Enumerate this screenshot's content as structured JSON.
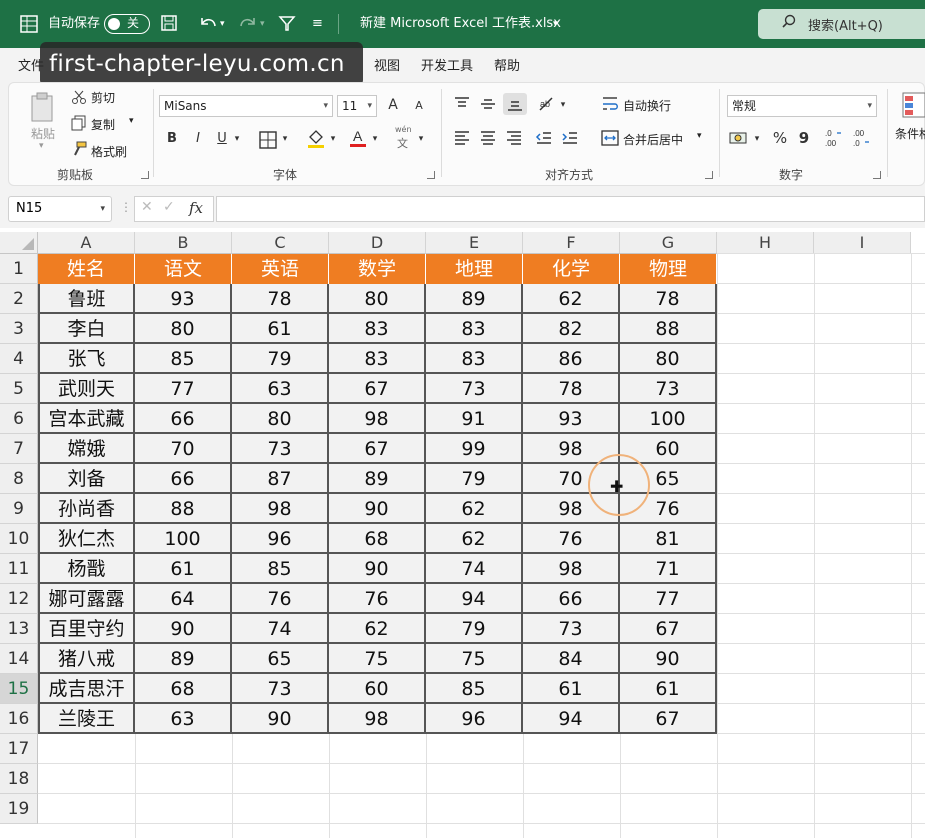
{
  "titlebar": {
    "autosave_label": "自动保存",
    "autosave_state": "关",
    "filename": "新建 Microsoft Excel 工作表.xlsx",
    "search_label": "搜索(Alt+Q)",
    "accent": "#1e7145"
  },
  "menu": {
    "items": [
      "文件",
      "视图",
      "开发工具",
      "帮助"
    ]
  },
  "watermark": "first-chapter-leyu.com.cn",
  "ribbon": {
    "clipboard": {
      "paste": "粘贴",
      "cut": "剪切",
      "copy": "复制",
      "format_painter": "格式刷",
      "group": "剪贴板"
    },
    "font": {
      "name": "MiSans",
      "size": "11",
      "grow": "A",
      "shrink": "A",
      "bold": "B",
      "italic": "I",
      "underline": "U",
      "phonetic_top": "wén",
      "phonetic_bottom": "文",
      "group": "字体"
    },
    "alignment": {
      "wrap": "自动换行",
      "merge": "合并后居中",
      "group": "对齐方式"
    },
    "number": {
      "format": "常规",
      "percent": "%",
      "comma": "9",
      "group": "数字"
    },
    "styles": {
      "cond": "条件格"
    }
  },
  "formula_bar": {
    "namebox": "N15",
    "fx": "fx",
    "formula": ""
  },
  "grid": {
    "columns": [
      "A",
      "B",
      "C",
      "D",
      "E",
      "F",
      "G",
      "H",
      "I"
    ],
    "rows": [
      "1",
      "2",
      "3",
      "4",
      "5",
      "6",
      "7",
      "8",
      "9",
      "10",
      "11",
      "12",
      "13",
      "14",
      "15",
      "16",
      "17",
      "18",
      "19"
    ],
    "selected_row": "15",
    "header_color": "#ef7d22",
    "headers": [
      "姓名",
      "语文",
      "英语",
      "数学",
      "地理",
      "化学",
      "物理"
    ],
    "data": [
      [
        "鲁班",
        "93",
        "78",
        "80",
        "89",
        "62",
        "78"
      ],
      [
        "李白",
        "80",
        "61",
        "83",
        "83",
        "82",
        "88"
      ],
      [
        "张飞",
        "85",
        "79",
        "83",
        "83",
        "86",
        "80"
      ],
      [
        "武则天",
        "77",
        "63",
        "67",
        "73",
        "78",
        "73"
      ],
      [
        "宫本武藏",
        "66",
        "80",
        "98",
        "91",
        "93",
        "100"
      ],
      [
        "嫦娥",
        "70",
        "73",
        "67",
        "99",
        "98",
        "60"
      ],
      [
        "刘备",
        "66",
        "87",
        "89",
        "79",
        "70",
        "65"
      ],
      [
        "孙尚香",
        "88",
        "98",
        "90",
        "62",
        "98",
        "76"
      ],
      [
        "狄仁杰",
        "100",
        "96",
        "68",
        "62",
        "76",
        "81"
      ],
      [
        "杨戬",
        "61",
        "85",
        "90",
        "74",
        "98",
        "71"
      ],
      [
        "娜可露露",
        "64",
        "76",
        "76",
        "94",
        "66",
        "77"
      ],
      [
        "百里守约",
        "90",
        "74",
        "62",
        "79",
        "73",
        "67"
      ],
      [
        "猪八戒",
        "89",
        "65",
        "75",
        "75",
        "84",
        "90"
      ],
      [
        "成吉思汗",
        "68",
        "73",
        "60",
        "85",
        "61",
        "61"
      ],
      [
        "兰陵王",
        "63",
        "90",
        "98",
        "96",
        "94",
        "67"
      ]
    ]
  }
}
